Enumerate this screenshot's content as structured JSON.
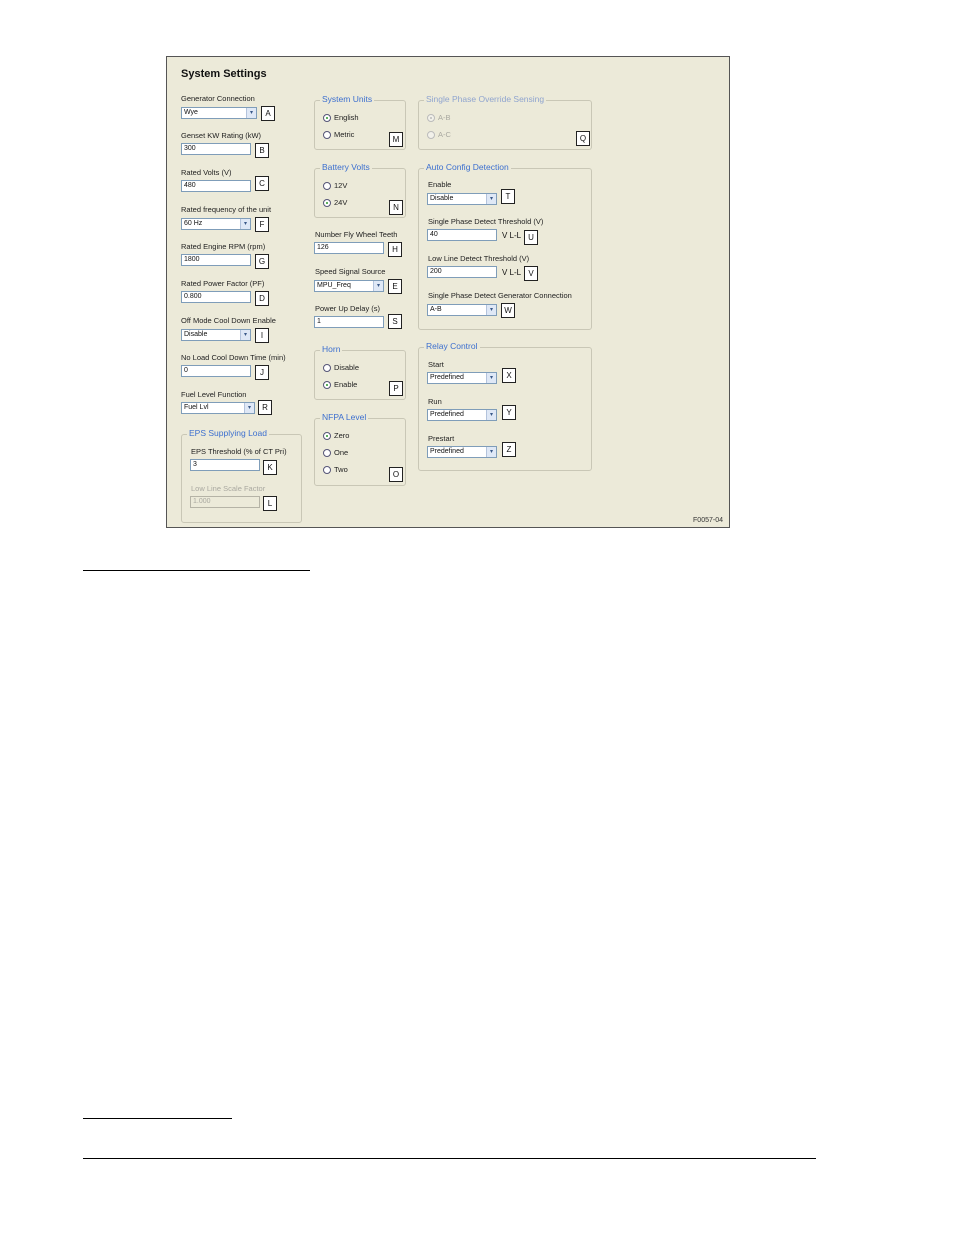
{
  "panel": {
    "title": "System Settings",
    "figure_id": "F0057-04"
  },
  "left_fields": {
    "generator_connection": {
      "label": "Generator Connection",
      "value": "Wye",
      "tag": "A"
    },
    "genset_kw": {
      "label": "Genset KW Rating (kW)",
      "value": "300",
      "tag": "B"
    },
    "rated_volts": {
      "label": "Rated Volts (V)",
      "value": "480",
      "tag": "C"
    },
    "rated_freq": {
      "label": "Rated frequency of the unit",
      "value": "60 Hz",
      "tag": "F"
    },
    "rated_rpm": {
      "label": "Rated Engine RPM (rpm)",
      "value": "1800",
      "tag": "G"
    },
    "rated_pf": {
      "label": "Rated Power Factor (PF)",
      "value": "0.800",
      "tag": "D"
    },
    "off_mode_cooldown": {
      "label": "Off Mode Cool Down Enable",
      "value": "Disable",
      "tag": "I"
    },
    "no_load_cooldown": {
      "label": "No Load Cool Down Time (min)",
      "value": "0",
      "tag": "J"
    },
    "fuel_level": {
      "label": "Fuel Level Function",
      "value": "Fuel Lvl",
      "tag": "R"
    }
  },
  "eps": {
    "title": "EPS Supplying Load",
    "threshold": {
      "label": "EPS Threshold (% of CT Pri)",
      "value": "3",
      "tag": "K"
    },
    "low_line": {
      "label": "Low Line Scale Factor",
      "value": "1.000",
      "tag": "L"
    }
  },
  "system_units": {
    "title": "System Units",
    "options": [
      "English",
      "Metric"
    ],
    "selected": "English",
    "tag": "M"
  },
  "battery_volts": {
    "title": "Battery Volts",
    "options": [
      "12V",
      "24V"
    ],
    "selected": "24V",
    "tag": "N"
  },
  "mid_fields": {
    "fly_wheel": {
      "label": "Number Fly Wheel Teeth",
      "value": "126",
      "tag": "H"
    },
    "speed_signal": {
      "label": "Speed Signal Source",
      "value": "MPU_Freq",
      "tag": "E"
    },
    "power_up_delay": {
      "label": "Power Up Delay (s)",
      "value": "1",
      "tag": "S"
    }
  },
  "horn": {
    "title": "Horn",
    "options": [
      "Disable",
      "Enable"
    ],
    "selected": "Enable",
    "tag": "P"
  },
  "nfpa": {
    "title": "NFPA Level",
    "options": [
      "Zero",
      "One",
      "Two"
    ],
    "selected": "Zero",
    "tag": "O"
  },
  "single_phase_override": {
    "title": "Single Phase Override Sensing",
    "options": [
      "A-B",
      "A-C"
    ],
    "selected": "A-B",
    "tag": "Q"
  },
  "auto_config": {
    "title": "Auto Config Detection",
    "enable": {
      "label": "Enable",
      "value": "Disable",
      "tag": "T"
    },
    "sp_threshold": {
      "label": "Single Phase Detect Threshold (V)",
      "value": "40",
      "unit": "V L-L",
      "tag": "U"
    },
    "low_line_threshold": {
      "label": "Low Line Detect Threshold (V)",
      "value": "200",
      "unit": "V L-L",
      "tag": "V"
    },
    "sp_gen_conn": {
      "label": "Single Phase Detect Generator Connection",
      "value": "A-B",
      "tag": "W"
    }
  },
  "relay_control": {
    "title": "Relay Control",
    "start": {
      "label": "Start",
      "value": "Predefined",
      "tag": "X"
    },
    "run": {
      "label": "Run",
      "value": "Predefined",
      "tag": "Y"
    },
    "prestart": {
      "label": "Prestart",
      "value": "Predefined",
      "tag": "Z"
    }
  },
  "icons": {
    "dropdown_arrow": "▾"
  },
  "colors": {
    "panel_bg": "#ecead9",
    "group_title": "#3c6fcf",
    "radio_selected": "#2a9a2a"
  }
}
